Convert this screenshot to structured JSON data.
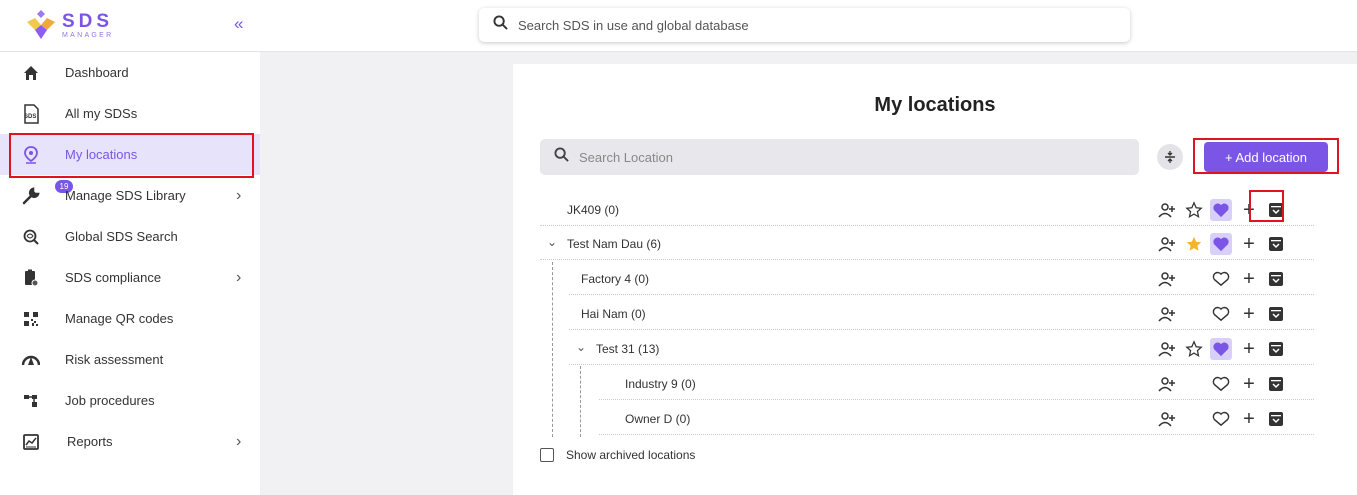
{
  "header": {
    "logo_main": "SDS",
    "logo_sub": "MANAGER",
    "collapse_label": "«",
    "search_placeholder": "Search SDS in use and global database"
  },
  "sidebar": {
    "items": [
      {
        "label": "Dashboard",
        "icon": "home-icon"
      },
      {
        "label": "All my SDSs",
        "icon": "sds-document-icon"
      },
      {
        "label": "My locations",
        "icon": "location-pin-icon",
        "active": true
      },
      {
        "label": "Manage SDS Library",
        "icon": "wrench-icon",
        "badge": "19",
        "chevron": "›"
      },
      {
        "label": "Global SDS Search",
        "icon": "global-search-icon"
      },
      {
        "label": "SDS compliance",
        "icon": "compliance-icon",
        "chevron": "›"
      },
      {
        "label": "Manage QR codes",
        "icon": "qr-code-icon"
      },
      {
        "label": "Risk assessment",
        "icon": "risk-gauge-icon"
      },
      {
        "label": "Job procedures",
        "icon": "procedures-icon"
      },
      {
        "label": "Reports",
        "icon": "reports-icon",
        "chevron": "›"
      }
    ]
  },
  "main": {
    "title": "My locations",
    "search_placeholder": "Search Location",
    "add_button": "+ Add location",
    "show_archived": "Show archived locations"
  },
  "locations": [
    {
      "name": "JK409 (0)",
      "star": "outline",
      "heart": "filled"
    },
    {
      "name": "Test Nam Dau (6)",
      "expanded": true,
      "star": "filled",
      "heart": "filled"
    },
    {
      "name": "Factory 4 (0)",
      "star": "none",
      "heart": "outline"
    },
    {
      "name": "Hai Nam (0)",
      "star": "none",
      "heart": "outline"
    },
    {
      "name": "Test 31 (13)",
      "expanded": true,
      "star": "outline",
      "heart": "filled"
    },
    {
      "name": "Industry 9 (0)",
      "star": "none",
      "heart": "outline"
    },
    {
      "name": "Owner D (0)",
      "star": "none",
      "heart": "outline"
    }
  ],
  "colors": {
    "accent": "#7b55e6",
    "highlight_border": "#e0141e",
    "star_filled": "#f4b52a",
    "heart_bg": "#d9d0fa"
  }
}
